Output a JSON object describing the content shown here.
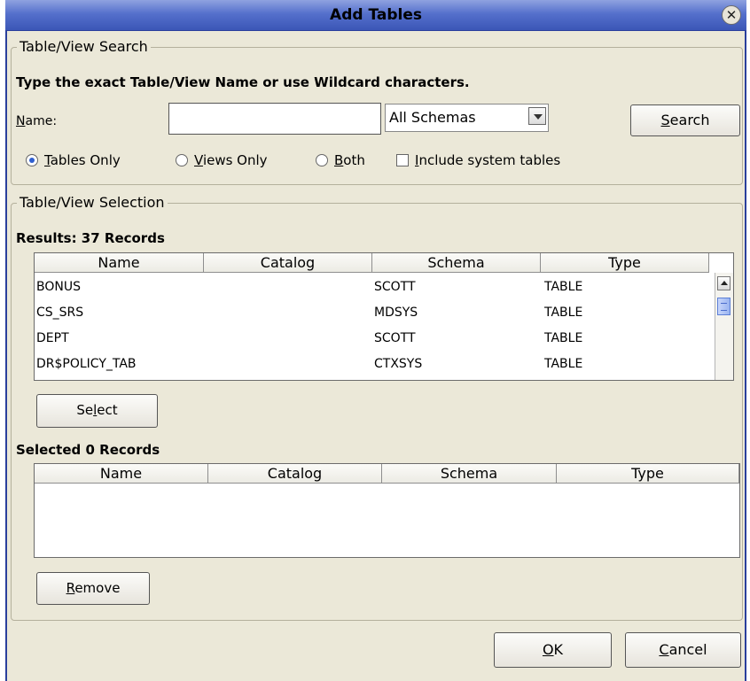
{
  "dialog": {
    "title": "Add Tables"
  },
  "search": {
    "legend": "Table/View Search",
    "instruction": "Type the exact Table/View Name or use Wildcard characters.",
    "name_label_mnemonic": "N",
    "name_label_rest": "ame:",
    "name_value": "",
    "schema_selected": "All Schemas",
    "search_button_mnemonic": "S",
    "search_button_rest": "earch",
    "radio_tables_mnemonic": "T",
    "radio_tables_rest": "ables Only",
    "radio_views_mnemonic": "V",
    "radio_views_rest": "iews Only",
    "radio_both_mnemonic": "B",
    "radio_both_rest": "oth",
    "checkbox_system_mnemonic": "I",
    "checkbox_system_rest": "nclude system tables"
  },
  "selection": {
    "legend": "Table/View Selection",
    "results_label": "Results: 37 Records",
    "columns": [
      "Name",
      "Catalog",
      "Schema",
      "Type"
    ],
    "rows": [
      [
        "BONUS",
        "",
        "SCOTT",
        "TABLE"
      ],
      [
        "CS_SRS",
        "",
        "MDSYS",
        "TABLE"
      ],
      [
        "DEPT",
        "",
        "SCOTT",
        "TABLE"
      ],
      [
        "DR$POLICY_TAB",
        "",
        "CTXSYS",
        "TABLE"
      ]
    ],
    "select_button_pre": "Se",
    "select_button_mnemonic": "l",
    "select_button_post": "ect",
    "selected_label": "Selected 0 Records",
    "selected_columns": [
      "Name",
      "Catalog",
      "Schema",
      "Type"
    ],
    "remove_button_mnemonic": "R",
    "remove_button_rest": "emove"
  },
  "footer": {
    "ok_mnemonic": "O",
    "ok_rest": "K",
    "cancel_mnemonic": "C",
    "cancel_rest": "ancel"
  },
  "colors": {
    "title_bar": "#3b56b6",
    "dialog_bg": "#ebe8d8",
    "radio_selected": "#2f5fcf"
  },
  "icons": {
    "close": "close-icon",
    "dropdown": "chevron-down-icon",
    "scroll_up": "arrow-up-icon"
  }
}
